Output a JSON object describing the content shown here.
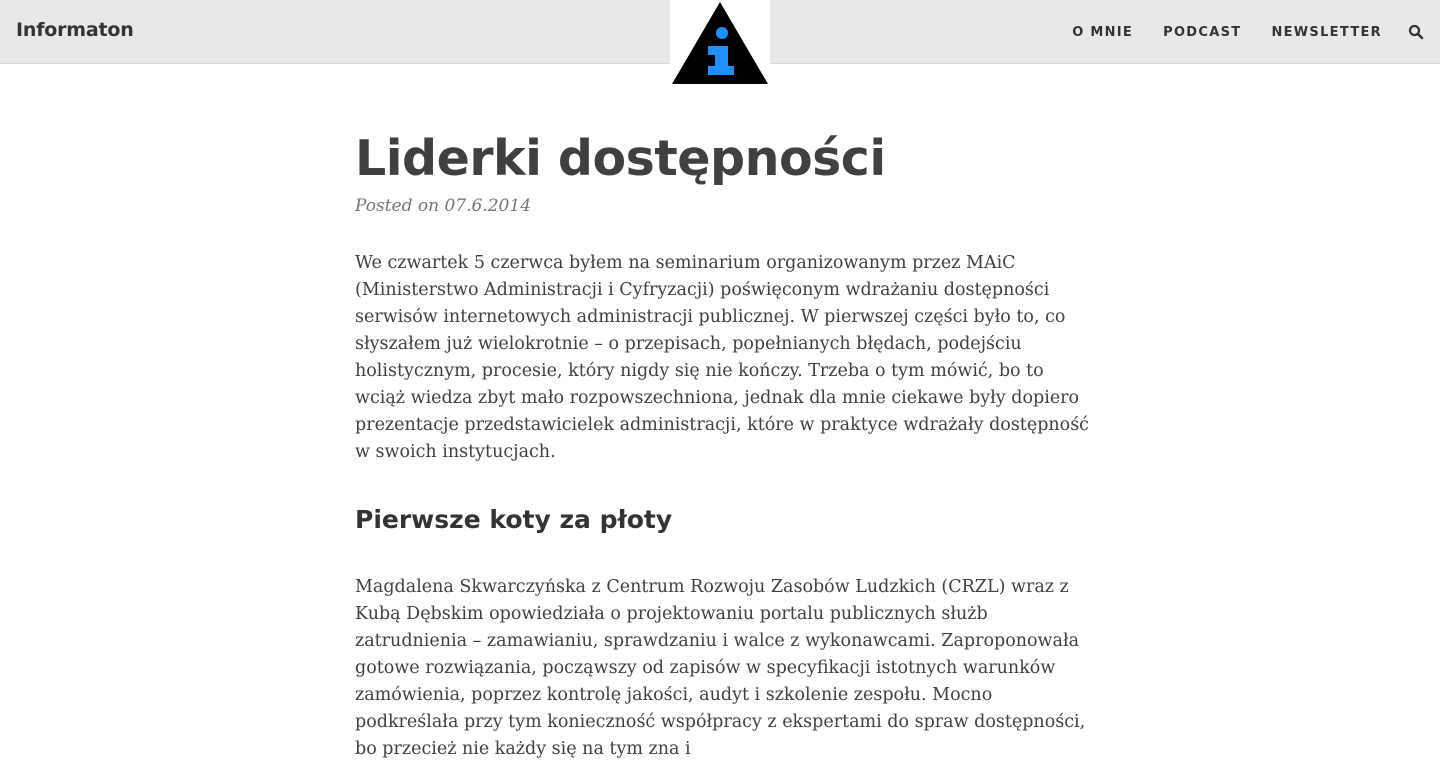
{
  "header": {
    "site_title": "Informaton",
    "logo_icon": "info-triangle-logo-icon",
    "nav": [
      {
        "label": "O MNIE"
      },
      {
        "label": "PODCAST"
      },
      {
        "label": "NEWSLETTER"
      }
    ],
    "search_icon": "search-icon"
  },
  "post": {
    "title": "Liderki dostępności",
    "meta_prefix": "Posted on",
    "date": "07.6.2014",
    "paragraph1": "We czwartek 5 czerwca byłem na seminarium organizowanym przez MAiC (Ministerstwo Administracji i Cyfryzacji) poświęconym wdrażaniu dostępności serwisów internetowych administracji publicznej. W pierwszej części było to, co słyszałem już wielokrotnie – o przepisach, popełnianych błędach, podejściu holistycznym, procesie, który nigdy się nie kończy. Trzeba o tym mówić, bo to wciąż wiedza zbyt mało rozpowszechniona, jednak dla mnie ciekawe były dopiero prezentacje przedstawicielek administracji, które w praktyce wdrażały dostępność w swoich instytucjach.",
    "section_heading": "Pierwsze koty za płoty",
    "paragraph2": "Magdalena Skwarczyńska z Centrum Rozwoju Zasobów Ludzkich (CRZL) wraz z Kubą Dębskim opowiedziała o projektowaniu portalu publicznych służb zatrudnienia – zamawianiu, sprawdzaniu i walce z wykonawcami. Zaproponowała gotowe rozwiązania, począwszy od zapisów w specyfikacji istotnych warunków zamówienia, poprzez kontrolę jakości, audyt i szkolenie zespołu. Mocno podkreślała przy tym konieczność współpracy z ekspertami do spraw dostępności, bo przecież nie każdy się na tym zna i"
  },
  "colors": {
    "header_bg": "#e8e8e8",
    "text": "#404040",
    "meta": "#757575",
    "logo_triangle": "#000000",
    "logo_i": "#1e90ff"
  }
}
